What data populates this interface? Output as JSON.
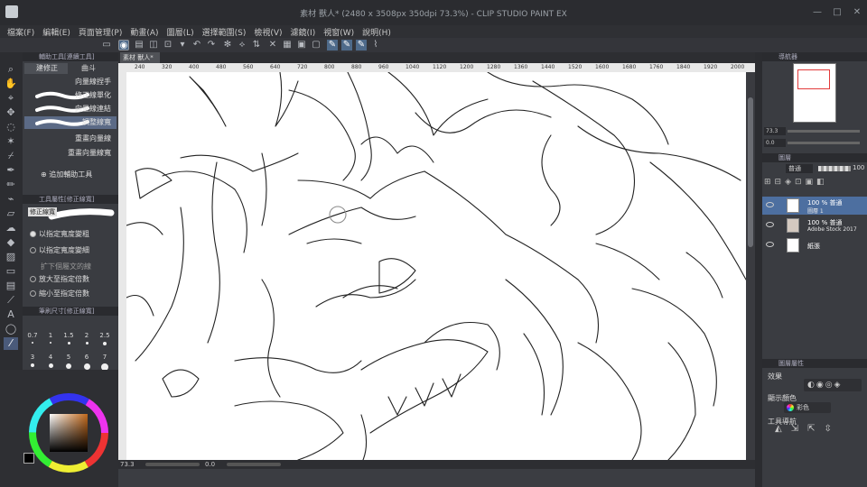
{
  "window": {
    "title": "素材 獸人* (2480 x 3508px 350dpi 73.3%) - CLIP STUDIO PAINT EX",
    "minimize": "—",
    "maximize": "□",
    "close": "✕"
  },
  "menu": [
    "檔案(F)",
    "編輯(E)",
    "頁面管理(P)",
    "動畫(A)",
    "圖層(L)",
    "選擇範圍(S)",
    "檢視(V)",
    "濾鏡(I)",
    "視窗(W)",
    "說明(H)"
  ],
  "subtool_panel": {
    "header": "輔助工具[連續工具]",
    "tabs": [
      "建修正",
      "曲斗"
    ],
    "items": [
      {
        "label": "向量線捏手"
      },
      {
        "label": "修正線單化"
      },
      {
        "label": "向量線連結"
      },
      {
        "label": "調整線寬"
      },
      {
        "label": "重畫向量線"
      },
      {
        "label": "重畫向量線寬"
      }
    ],
    "add_button": "追加輔助工具"
  },
  "tool_property": {
    "header": "工具屬性[修正線寬]",
    "name": "修正線寬",
    "options": [
      {
        "label": "以指定寬度變粗",
        "on": true
      },
      {
        "label": "以指定寬度變細",
        "on": false
      },
      {
        "label": "放大至指定倍數",
        "on": false
      },
      {
        "label": "縮小至指定倍數",
        "on": false
      }
    ],
    "extra": "扩下個屬文的線"
  },
  "brush_size": {
    "header": "筆刷尺寸[修正線寬]",
    "sizes": [
      "0.7",
      "1",
      "1.5",
      "2",
      "2.5",
      "3",
      "4",
      "5",
      "6",
      "7"
    ]
  },
  "document_tab": "素材 獸人*",
  "ruler": {
    "ticks": [
      "240",
      "320",
      "400",
      "480",
      "560",
      "640",
      "720",
      "800",
      "880",
      "960",
      "1040",
      "1120",
      "1200",
      "1280",
      "1360",
      "1440",
      "1520",
      "1600",
      "1680",
      "1760",
      "1840",
      "1920",
      "2000"
    ]
  },
  "status": {
    "zoom": "73.3",
    "angle": "0.0"
  },
  "navigator": {
    "header": "導航器",
    "zoom": "73.3",
    "angle": "0.0"
  },
  "layers": {
    "header": "圖層",
    "blend": "普通",
    "opacity": "100",
    "items": [
      {
        "line1": "100 % 普通",
        "line2": "圖層 1",
        "selected": true
      },
      {
        "line1": "100 % 普通",
        "line2": "Adobe Stock 2017",
        "selected": false
      },
      {
        "line1": "紙張",
        "line2": "",
        "selected": false
      }
    ]
  },
  "layer_property": {
    "header": "圖層屬性",
    "effect_label": "效果",
    "display_color_label": "顯示顏色",
    "color_value": "彩色",
    "tool_nav_label": "工具導航"
  },
  "colors": {
    "main": "#000000",
    "sub": "#ffffff",
    "selection_blue": "#4d6fa0"
  }
}
